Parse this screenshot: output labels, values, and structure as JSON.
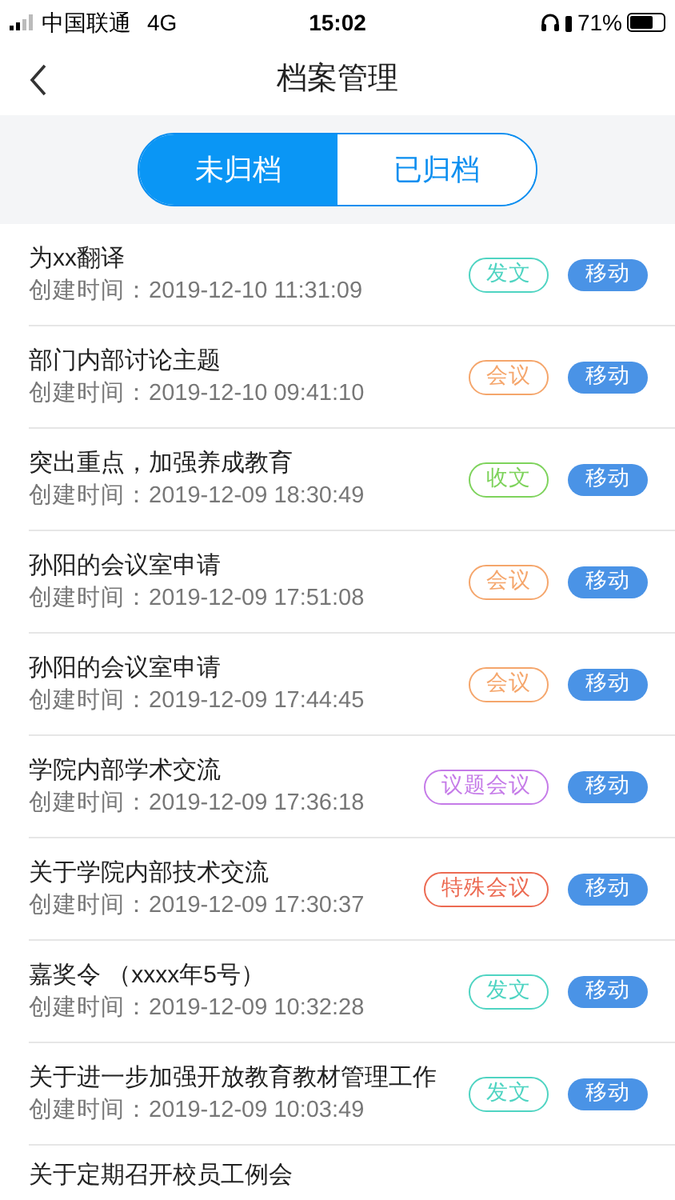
{
  "status_bar": {
    "carrier": "中国联通",
    "network": "4G",
    "time": "15:02",
    "battery": "71%"
  },
  "nav": {
    "title": "档案管理"
  },
  "tabs": [
    {
      "label": "未归档",
      "selected": true
    },
    {
      "label": "已归档",
      "selected": false
    }
  ],
  "items": [
    {
      "title": "为xx翻译",
      "created": "创建时间：2019-12-10 11:31:09",
      "tag": "发文",
      "color": "#4fd4c2",
      "action": "移动"
    },
    {
      "title": "部门内部讨论主题",
      "created": "创建时间：2019-12-10 09:41:10",
      "tag": "会议",
      "color": "#f5a66c",
      "action": "移动"
    },
    {
      "title": "突出重点，加强养成教育",
      "created": "创建时间：2019-12-09 18:30:49",
      "tag": "收文",
      "color": "#7ed35c",
      "action": "移动"
    },
    {
      "title": "孙阳的会议室申请",
      "created": "创建时间：2019-12-09 17:51:08",
      "tag": "会议",
      "color": "#f5a66c",
      "action": "移动"
    },
    {
      "title": "孙阳的会议室申请",
      "created": "创建时间：2019-12-09 17:44:45",
      "tag": "会议",
      "color": "#f5a66c",
      "action": "移动"
    },
    {
      "title": "学院内部学术交流",
      "created": "创建时间：2019-12-09 17:36:18",
      "tag": "议题会议",
      "color": "#c57be8",
      "action": "移动"
    },
    {
      "title": "关于学院内部技术交流",
      "created": "创建时间：2019-12-09 17:30:37",
      "tag": "特殊会议",
      "color": "#ec6a52",
      "action": "移动"
    },
    {
      "title": "嘉奖令 （xxxx年5号）",
      "created": "创建时间：2019-12-09 10:32:28",
      "tag": "发文",
      "color": "#4fd4c2",
      "action": "移动"
    },
    {
      "title": "关于进一步加强开放教育教材管理工作",
      "created": "创建时间：2019-12-09 10:03:49",
      "tag": "发文",
      "color": "#4fd4c2",
      "action": "移动"
    },
    {
      "title": "关于定期召开校员工例会"
    }
  ]
}
